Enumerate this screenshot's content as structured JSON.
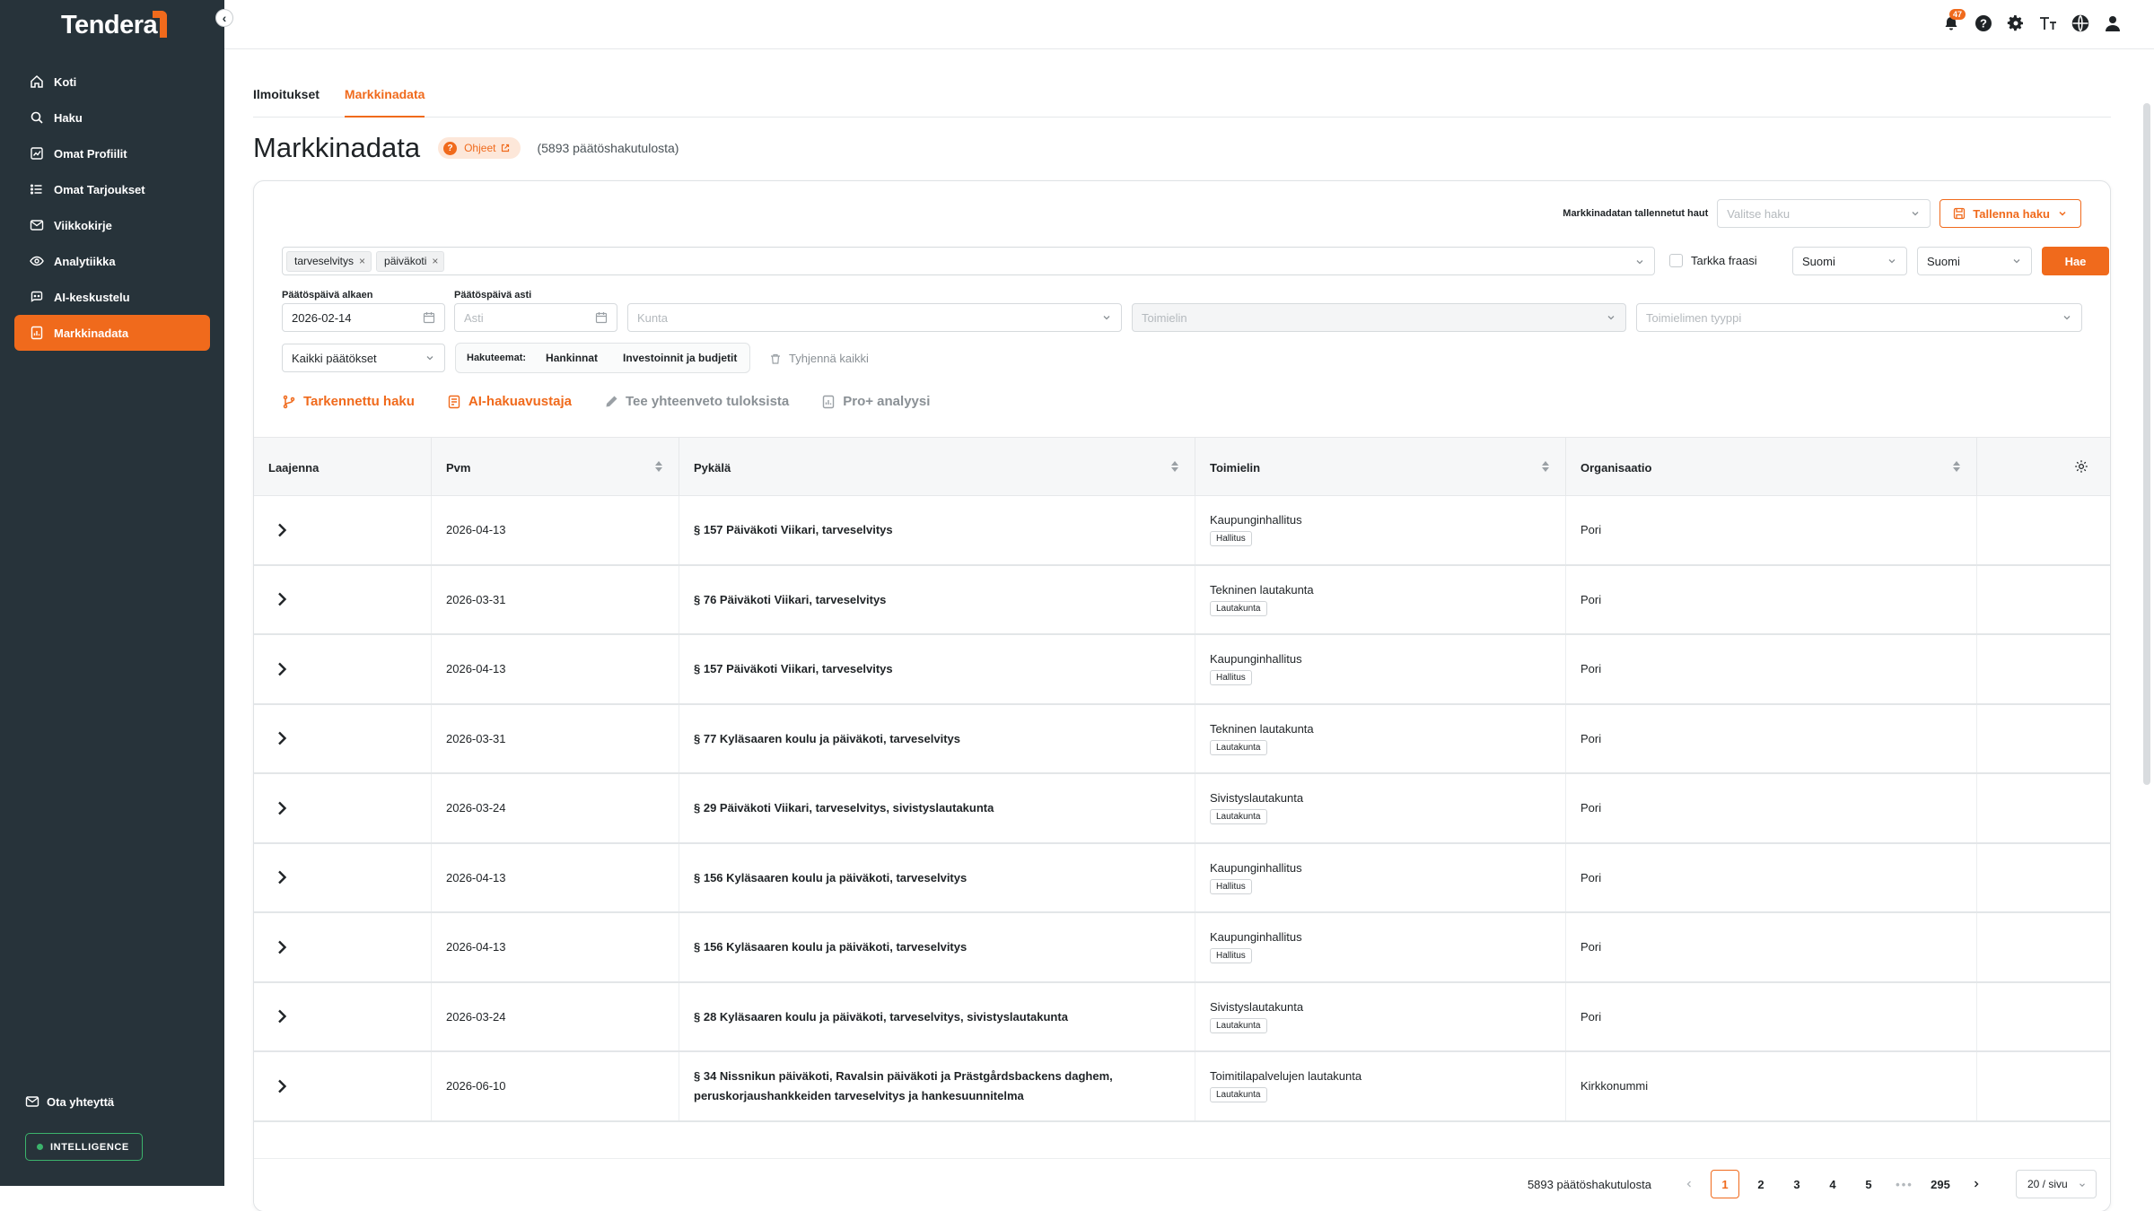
{
  "app": {
    "name": "Tendera"
  },
  "sidebar": {
    "items": [
      {
        "label": "Koti",
        "icon": "home-icon"
      },
      {
        "label": "Haku",
        "icon": "search-icon"
      },
      {
        "label": "Omat Profiilit",
        "icon": "chart-icon"
      },
      {
        "label": "Omat Tarjoukset",
        "icon": "list-icon"
      },
      {
        "label": "Viikkokirje",
        "icon": "mail-icon"
      },
      {
        "label": "Analytiikka",
        "icon": "eye-icon"
      },
      {
        "label": "AI-keskustelu",
        "icon": "chat-icon"
      },
      {
        "label": "Markkinadata",
        "icon": "document-chart-icon",
        "active": true
      }
    ],
    "contact_label": "Ota yhteyttä",
    "plan_badge": "INTELLIGENCE"
  },
  "topbar": {
    "notification_count": "47"
  },
  "tabs": [
    {
      "label": "Ilmoitukset",
      "active": false
    },
    {
      "label": "Markkinadata",
      "active": true
    }
  ],
  "page": {
    "title": "Markkinadata",
    "help_label": "Ohjeet",
    "result_count_text": "(5893 päätöshakutulosta)"
  },
  "filters": {
    "saved_searches_label": "Markkinadatan tallennetut haut",
    "saved_searches_placeholder": "Valitse haku",
    "save_search_label": "Tallenna haku",
    "keywords": [
      "tarveselvitys",
      "päiväkoti"
    ],
    "exact_phrase_label": "Tarkka fraasi",
    "language_1": "Suomi",
    "language_2": "Suomi",
    "search_button": "Hae",
    "date_from_label": "Päätöspäivä alkaen",
    "date_from_value": "2026-02-14",
    "date_to_label": "Päätöspäivä asti",
    "date_to_placeholder": "Asti",
    "municipality_placeholder": "Kunta",
    "body_placeholder": "Toimielin",
    "body_type_placeholder": "Toimielimen tyyppi",
    "decisions_select": "Kaikki päätökset",
    "themes_label": "Hakuteemat:",
    "theme_options": [
      "Hankinnat",
      "Investoinnit ja budjetit"
    ],
    "clear_all_label": "Tyhjennä kaikki"
  },
  "tools": {
    "advanced_search": "Tarkennettu haku",
    "ai_assistant": "AI-hakuavustaja",
    "summary": "Tee yhteenveto tuloksista",
    "pro_analysis": "Pro+ analyysi"
  },
  "table": {
    "headers": {
      "expand": "Laajenna",
      "date": "Pvm",
      "section": "Pykälä",
      "body": "Toimielin",
      "organization": "Organisaatio"
    },
    "rows": [
      {
        "date": "2026-04-13",
        "section": "§ 157 Päiväkoti Viikari, tarveselvitys",
        "body": "Kaupunginhallitus",
        "body_type": "Hallitus",
        "organization": "Pori"
      },
      {
        "date": "2026-03-31",
        "section": "§ 76 Päiväkoti Viikari, tarveselvitys",
        "body": "Tekninen lautakunta",
        "body_type": "Lautakunta",
        "organization": "Pori"
      },
      {
        "date": "2026-04-13",
        "section": "§ 157 Päiväkoti Viikari, tarveselvitys",
        "body": "Kaupunginhallitus",
        "body_type": "Hallitus",
        "organization": "Pori"
      },
      {
        "date": "2026-03-31",
        "section": "§ 77 Kyläsaaren koulu ja päiväkoti, tarveselvitys",
        "body": "Tekninen lautakunta",
        "body_type": "Lautakunta",
        "organization": "Pori"
      },
      {
        "date": "2026-03-24",
        "section": "§ 29 Päiväkoti Viikari, tarveselvitys, sivistyslautakunta",
        "body": "Sivistyslautakunta",
        "body_type": "Lautakunta",
        "organization": "Pori"
      },
      {
        "date": "2026-04-13",
        "section": "§ 156 Kyläsaaren koulu ja päiväkoti, tarveselvitys",
        "body": "Kaupunginhallitus",
        "body_type": "Hallitus",
        "organization": "Pori"
      },
      {
        "date": "2026-04-13",
        "section": "§ 156 Kyläsaaren koulu ja päiväkoti, tarveselvitys",
        "body": "Kaupunginhallitus",
        "body_type": "Hallitus",
        "organization": "Pori"
      },
      {
        "date": "2026-03-24",
        "section": "§ 28 Kyläsaaren koulu ja päiväkoti, tarveselvitys, sivistyslautakunta",
        "body": "Sivistyslautakunta",
        "body_type": "Lautakunta",
        "organization": "Pori"
      },
      {
        "date": "2026-06-10",
        "section": "§ 34 Nissnikun päiväkoti, Ravalsin päiväkoti ja Prästgårdsbackens daghem, peruskorjaushankkeiden tarveselvitys ja hankesuunnitelma",
        "body": "Toimitilapalvelujen lautakunta",
        "body_type": "Lautakunta",
        "organization": "Kirkkonummi"
      }
    ]
  },
  "pagination": {
    "total_text": "5893 päätöshakutulosta",
    "pages": [
      "1",
      "2",
      "3",
      "4",
      "5",
      "295"
    ],
    "current": "1",
    "page_size": "20 / sivu"
  },
  "colors": {
    "accent": "#f06a1c",
    "sidebar_bg": "#27333a",
    "badge_green": "#3bb36c"
  }
}
